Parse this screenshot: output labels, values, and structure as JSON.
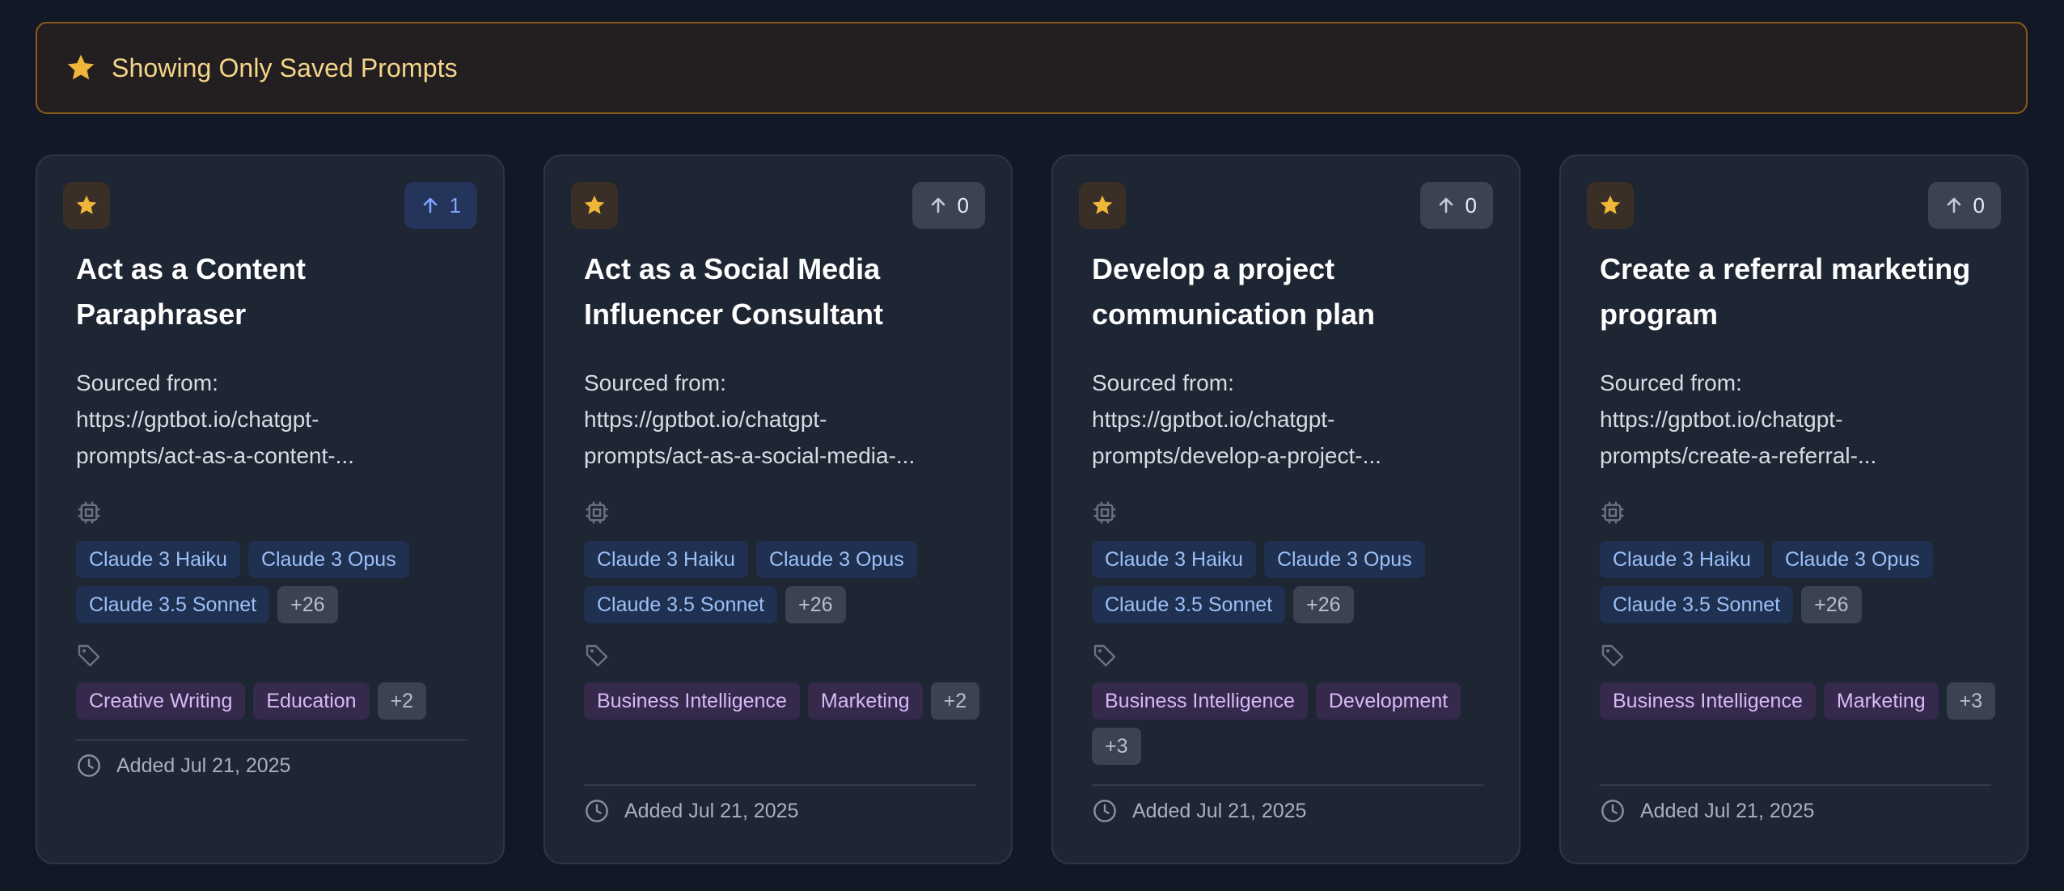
{
  "banner": {
    "text": "Showing Only Saved Prompts",
    "icon": "star-icon"
  },
  "colors": {
    "star": "#f0b63a",
    "vote_active": "#7ea6ff",
    "banner_text": "#f4d68a"
  },
  "cards": [
    {
      "title_line1": "Act as a Content",
      "title_line2": "Paraphraser",
      "desc_line1": "Sourced from:",
      "desc_line2": "https://gptbot.io/chatgpt-",
      "desc_line3": "prompts/act-as-a-content-...",
      "votes": "1",
      "models": [
        "Claude 3 Haiku",
        "Claude 3 Opus",
        "Claude 3.5 Sonnet"
      ],
      "models_more": "+26",
      "categories": [
        "Creative Writing",
        "Education"
      ],
      "categories_more": "+2",
      "added": "Added Jul 21, 2025"
    },
    {
      "title_line1": "Act as a Social Media",
      "title_line2": "Influencer Consultant",
      "desc_line1": "Sourced from:",
      "desc_line2": "https://gptbot.io/chatgpt-",
      "desc_line3": "prompts/act-as-a-social-media-...",
      "votes": "0",
      "models": [
        "Claude 3 Haiku",
        "Claude 3 Opus",
        "Claude 3.5 Sonnet"
      ],
      "models_more": "+26",
      "categories": [
        "Business Intelligence",
        "Marketing"
      ],
      "categories_more": "+2",
      "added": "Added Jul 21, 2025"
    },
    {
      "title_line1": "Develop a project",
      "title_line2": "communication plan",
      "desc_line1": "Sourced from:",
      "desc_line2": "https://gptbot.io/chatgpt-",
      "desc_line3": "prompts/develop-a-project-...",
      "votes": "0",
      "models": [
        "Claude 3 Haiku",
        "Claude 3 Opus",
        "Claude 3.5 Sonnet"
      ],
      "models_more": "+26",
      "categories": [
        "Business Intelligence",
        "Development"
      ],
      "categories_more": "+3",
      "added": "Added Jul 21, 2025"
    },
    {
      "title_line1": "Create a referral marketing",
      "title_line2": "program",
      "desc_line1": "Sourced from:",
      "desc_line2": "https://gptbot.io/chatgpt-",
      "desc_line3": "prompts/create-a-referral-...",
      "votes": "0",
      "models": [
        "Claude 3 Haiku",
        "Claude 3 Opus",
        "Claude 3.5 Sonnet"
      ],
      "models_more": "+26",
      "categories": [
        "Business Intelligence",
        "Marketing"
      ],
      "categories_more": "+3",
      "added": "Added Jul 21, 2025"
    }
  ]
}
